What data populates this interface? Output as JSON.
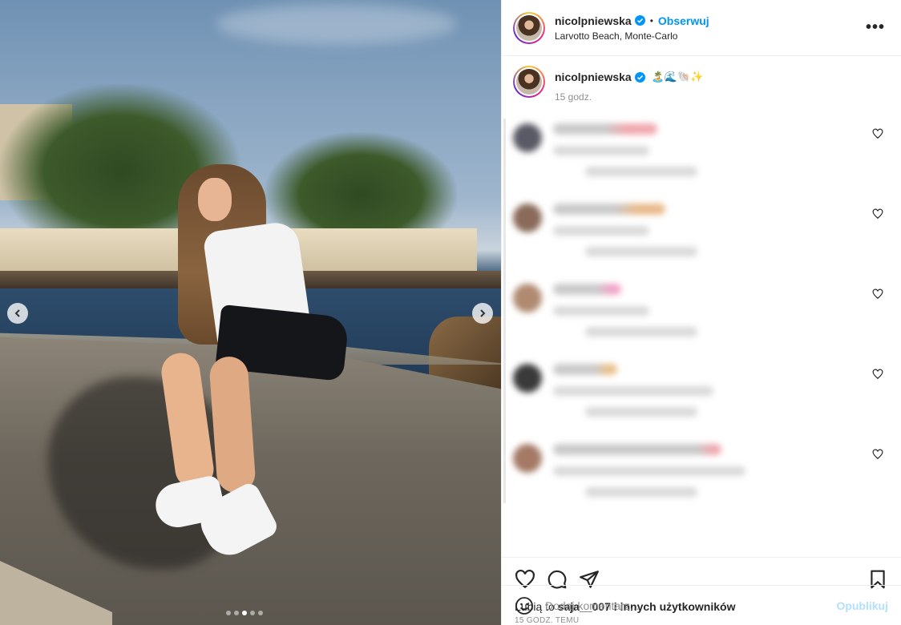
{
  "post": {
    "username": "nicolpniewska",
    "location": "Larvotto Beach, Monte-Carlo",
    "follow_label": "Obserwuj",
    "separator": "•",
    "more_label": "•••"
  },
  "caption": {
    "username": "nicolpniewska",
    "emojis": "🏝️🌊🐚✨",
    "time": "15 godz."
  },
  "likes": {
    "prefix": "Lubią to ",
    "user": "saja__007",
    "suffix": " i innych użytkowników"
  },
  "posted_ago": "15 GODZ. TEMU",
  "comment_box": {
    "placeholder": "Dodaj komentarz...",
    "publish_label": "Opublikuj"
  },
  "carousel": {
    "total": 5,
    "active": 2
  },
  "colors": {
    "accent": "#0095f6",
    "verified": "#0095f6",
    "publish_disabled": "#b2dffc"
  },
  "icons": [
    "chevron-left-icon",
    "chevron-right-icon",
    "verified-icon",
    "more-icon",
    "heart-icon",
    "comment-icon",
    "share-icon",
    "bookmark-icon",
    "emoji-icon"
  ]
}
